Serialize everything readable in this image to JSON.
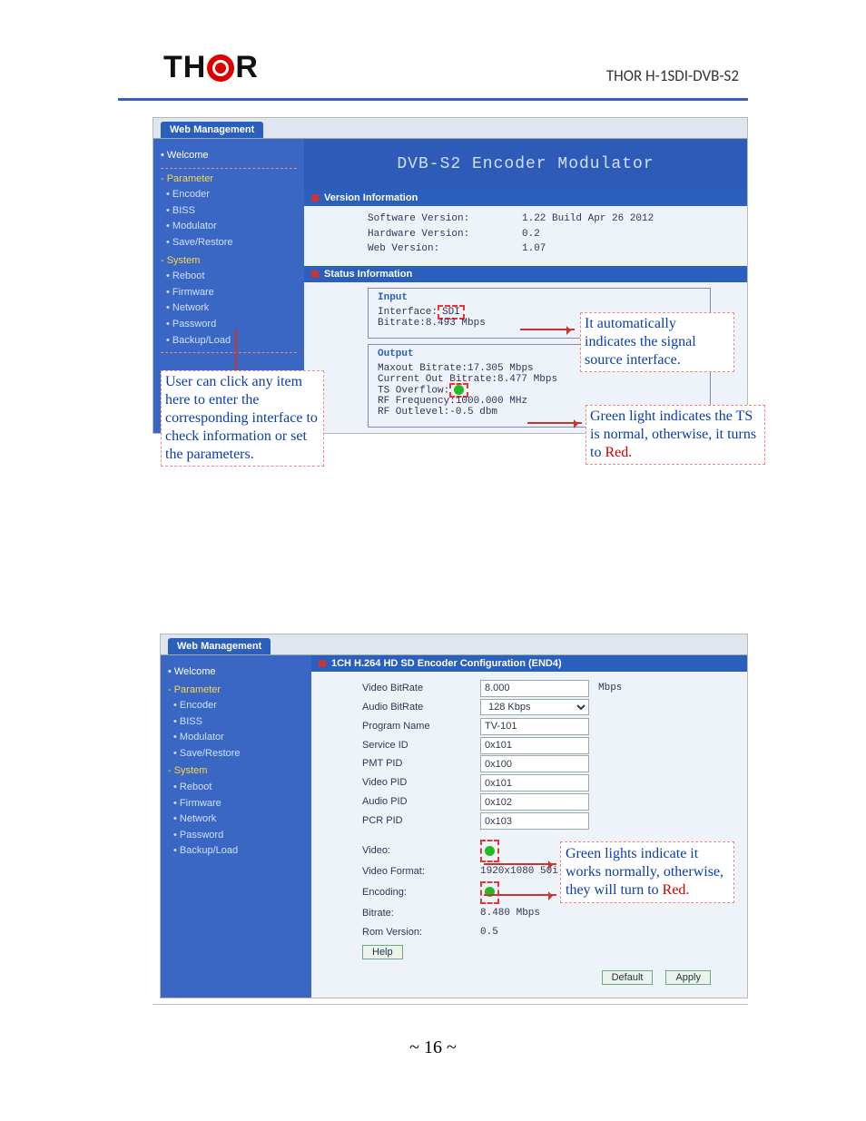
{
  "header": {
    "logo_left": "TH",
    "logo_right": "R",
    "title": "THOR H-1SDI-DVB-S2"
  },
  "shot1": {
    "tab": "Web Management",
    "sidebar": {
      "welcome": "• Welcome",
      "parameter": "- Parameter",
      "encoder": "• Encoder",
      "biss": "• BISS",
      "modulator": "• Modulator",
      "save": "• Save/Restore",
      "system": "- System",
      "reboot": "• Reboot",
      "firmware": "• Firmware",
      "network": "• Network",
      "password": "• Password",
      "backup": "• Backup/Load"
    },
    "banner": "DVB-S2 Encoder Modulator",
    "version": {
      "head": "Version Information",
      "software_k": "Software Version:",
      "software_v": "1.22 Build Apr 26 2012",
      "hardware_k": "Hardware Version:",
      "hardware_v": "0.2",
      "web_k": "Web Version:",
      "web_v": "1.07"
    },
    "status": {
      "head": "Status Information",
      "input_h": "Input",
      "interface_k": "Interface:",
      "interface_v": "SDI",
      "bitrate_k": "Bitrate:",
      "bitrate_v": "8.493 Mbps",
      "output_h": "Output",
      "maxout_k": "Maxout Bitrate:",
      "maxout_v": "17.305 Mbps",
      "current_k": "Current Out Bitrate:",
      "current_v": "8.477 Mbps",
      "tsovf_k": "TS Overflow:",
      "rffreq_k": "RF Frequency:",
      "rffreq_v": "1000.000 MHz",
      "rfout_k": "RF Outlevel:",
      "rfout_v": "-0.5 dbm"
    },
    "ann_left": "User can click any item here to enter the corresponding interface to check information or set the parameters.",
    "ann_iface": "It automatically indicates the signal source interface.",
    "ann_ts_a": "Green light indicates the TS is normal, otherwise, it turns to ",
    "ann_ts_red": "Red."
  },
  "shot2": {
    "tab": "Web Management",
    "sidebar": {
      "welcome": "• Welcome",
      "parameter": "- Parameter",
      "encoder": "• Encoder",
      "biss": "• BISS",
      "modulator": "• Modulator",
      "save": "• Save/Restore",
      "system": "- System",
      "reboot": "• Reboot",
      "firmware": "• Firmware",
      "network": "• Network",
      "password": "• Password",
      "backup": "• Backup/Load"
    },
    "cfg_head": "1CH H.264 HD SD Encoder Configuration (END4)",
    "fields": {
      "vbit_k": "Video BitRate",
      "vbit_v": "8.000",
      "vbit_u": "Mbps",
      "abit_k": "Audio BitRate",
      "abit_v": "128 Kbps",
      "pname_k": "Program Name",
      "pname_v": "TV-101",
      "sid_k": "Service ID",
      "sid_v": "0x101",
      "pmt_k": "PMT PID",
      "pmt_v": "0x100",
      "vpid_k": "Video PID",
      "vpid_v": "0x101",
      "apid_k": "Audio PID",
      "apid_v": "0x102",
      "pcr_k": "PCR PID",
      "pcr_v": "0x103",
      "video_k": "Video:",
      "vfmt_k": "Video Format:",
      "vfmt_v": "1920x1080 50i",
      "enc_k": "Encoding:",
      "br_k": "Bitrate:",
      "br_v": "8.480 Mbps",
      "rom_k": "Rom Version:",
      "rom_v": "0.5"
    },
    "buttons": {
      "help": "Help",
      "default": "Default",
      "apply": "Apply"
    },
    "ann_a": "Green lights indicate it works normally, otherwise, they will turn to ",
    "ann_red": "Red."
  },
  "page_no": "16"
}
